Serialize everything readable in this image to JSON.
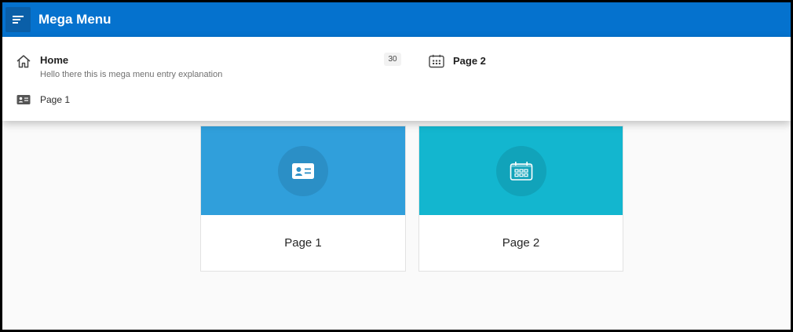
{
  "header": {
    "title": "Mega Menu",
    "menu_icon": "hamburger-menu-icon",
    "bg_color": "#0572ce"
  },
  "mega_menu": {
    "entries": [
      {
        "label": "Home",
        "description": "Hello there this is mega menu entry explanation",
        "badge": "30",
        "icon": "home-icon"
      },
      {
        "label": "Page 1",
        "icon": "id-card-icon"
      },
      {
        "label": "Page 2",
        "icon": "calendar-icon"
      }
    ]
  },
  "cards": [
    {
      "label": "Page 1",
      "color": "#309fdb",
      "icon": "id-card-icon"
    },
    {
      "label": "Page 2",
      "color": "#13b6cf",
      "icon": "calendar-icon"
    }
  ]
}
